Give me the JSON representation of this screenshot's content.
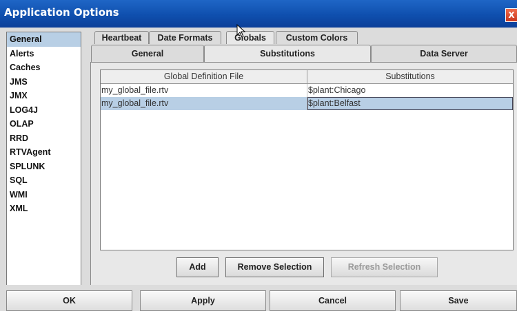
{
  "window": {
    "title": "Application Options",
    "close_glyph": "X"
  },
  "sidebar": {
    "items": [
      {
        "label": "General"
      },
      {
        "label": "Alerts"
      },
      {
        "label": "Caches"
      },
      {
        "label": "JMS"
      },
      {
        "label": "JMX"
      },
      {
        "label": "LOG4J"
      },
      {
        "label": "OLAP"
      },
      {
        "label": "RRD"
      },
      {
        "label": "RTVAgent"
      },
      {
        "label": "SPLUNK"
      },
      {
        "label": "SQL"
      },
      {
        "label": "WMI"
      },
      {
        "label": "XML"
      }
    ]
  },
  "tabs": {
    "row1": [
      {
        "label": "Heartbeat"
      },
      {
        "label": "Date Formats"
      },
      {
        "label": "Globals"
      },
      {
        "label": "Custom Colors"
      }
    ],
    "row2": [
      {
        "label": "General"
      },
      {
        "label": "Substitutions"
      },
      {
        "label": "Data Server"
      }
    ]
  },
  "table": {
    "headers": [
      "Global Definition File",
      "Substitutions"
    ],
    "rows": [
      {
        "file": "my_global_file.rtv",
        "subs": "$plant:Chicago"
      },
      {
        "file": "my_global_file.rtv",
        "subs": "$plant:Belfast"
      }
    ]
  },
  "actions": {
    "add": "Add",
    "remove": "Remove Selection",
    "refresh": "Refresh Selection"
  },
  "footer": {
    "ok": "OK",
    "apply": "Apply",
    "cancel": "Cancel",
    "save": "Save"
  }
}
